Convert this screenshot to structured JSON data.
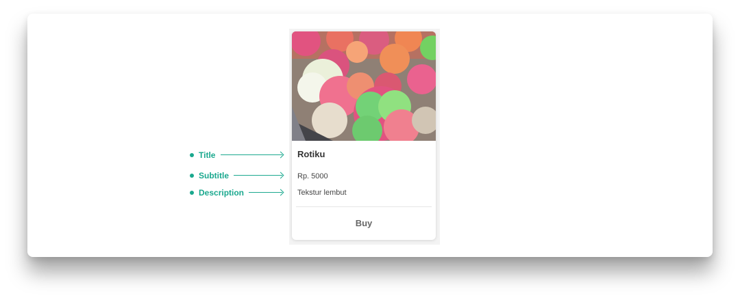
{
  "annotations": {
    "title_label": "Title",
    "subtitle_label": "Subtitle",
    "description_label": "Description"
  },
  "card": {
    "image_icon": "food-photo",
    "title": "Rotiku",
    "subtitle": "Rp. 5000",
    "description": "Tekstur lembut",
    "button_label": "Buy"
  },
  "colors": {
    "accent": "#1aa88e",
    "card_background": "#ffffff",
    "canvas_background": "#ffffff"
  }
}
